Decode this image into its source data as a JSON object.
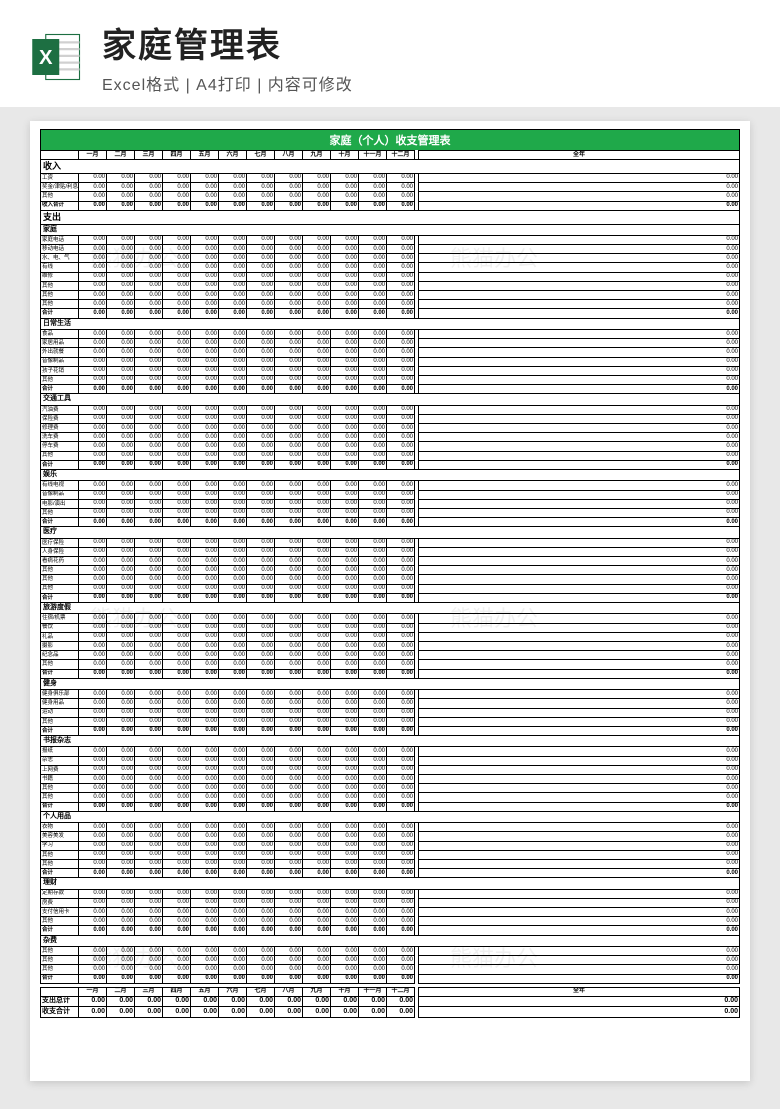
{
  "header": {
    "title": "家庭管理表",
    "subtitle": "Excel格式 | A4打印 | 内容可修改",
    "icon_name": "excel-icon"
  },
  "sheet": {
    "title": "家庭（个人）收支管理表",
    "months": [
      "一月",
      "二月",
      "三月",
      "四月",
      "五月",
      "六月",
      "七月",
      "八月",
      "九月",
      "十月",
      "十一月",
      "十二月"
    ],
    "year_label": "全年",
    "zero": "0.00",
    "income": {
      "heading": "收入",
      "rows": [
        "工资",
        "奖金/津贴/利息/…",
        "其他"
      ],
      "subtotal": "收入合计"
    },
    "expense_heading": "支出",
    "groups": [
      {
        "name": "家庭",
        "rows": [
          "家庭电话",
          "移动电话",
          "水、电、气",
          "有线",
          "维修",
          "其他",
          "其他",
          "其他"
        ],
        "subtotal": "合计"
      },
      {
        "name": "日常生活",
        "rows": [
          "食品",
          "家居用品",
          "外出就餐",
          "音像制品",
          "孩子花销",
          "其他"
        ],
        "subtotal": "合计"
      },
      {
        "name": "交通工具",
        "rows": [
          "汽油费",
          "保险费",
          "修理费",
          "洗车费",
          "停车费",
          "其他"
        ],
        "subtotal": "合计"
      },
      {
        "name": "娱乐",
        "rows": [
          "有线电视",
          "音像制品",
          "电影/演出",
          "其他"
        ],
        "subtotal": "合计"
      },
      {
        "name": "医疗",
        "rows": [
          "医疗保险",
          "人身保险",
          "看病花药",
          "其他",
          "其他",
          "其他"
        ],
        "subtotal": "合计"
      },
      {
        "name": "旅游度假",
        "rows": [
          "住宿/机票",
          "餐饮",
          "礼品",
          "摄影",
          "纪念品",
          "其他"
        ],
        "subtotal": "合计"
      },
      {
        "name": "健身",
        "rows": [
          "健身俱乐部",
          "健身用品",
          "运动",
          "其他"
        ],
        "subtotal": "合计"
      },
      {
        "name": "书报杂志",
        "rows": [
          "报纸",
          "杂志",
          "上网费",
          "书籍",
          "其他",
          "其他"
        ],
        "subtotal": "合计"
      },
      {
        "name": "个人用品",
        "rows": [
          "衣物",
          "美容美发",
          "学习",
          "其他",
          "其他"
        ],
        "subtotal": "合计"
      },
      {
        "name": "理财",
        "rows": [
          "定期存款",
          "房费",
          "支付信用卡",
          "其他"
        ],
        "subtotal": "合计"
      },
      {
        "name": "杂费",
        "rows": [
          "其他",
          "其他",
          "其他"
        ],
        "subtotal": "合计"
      }
    ],
    "footer": {
      "expense_total": "支出总计",
      "balance": "收支合计"
    }
  },
  "watermark": "熊猫办公"
}
